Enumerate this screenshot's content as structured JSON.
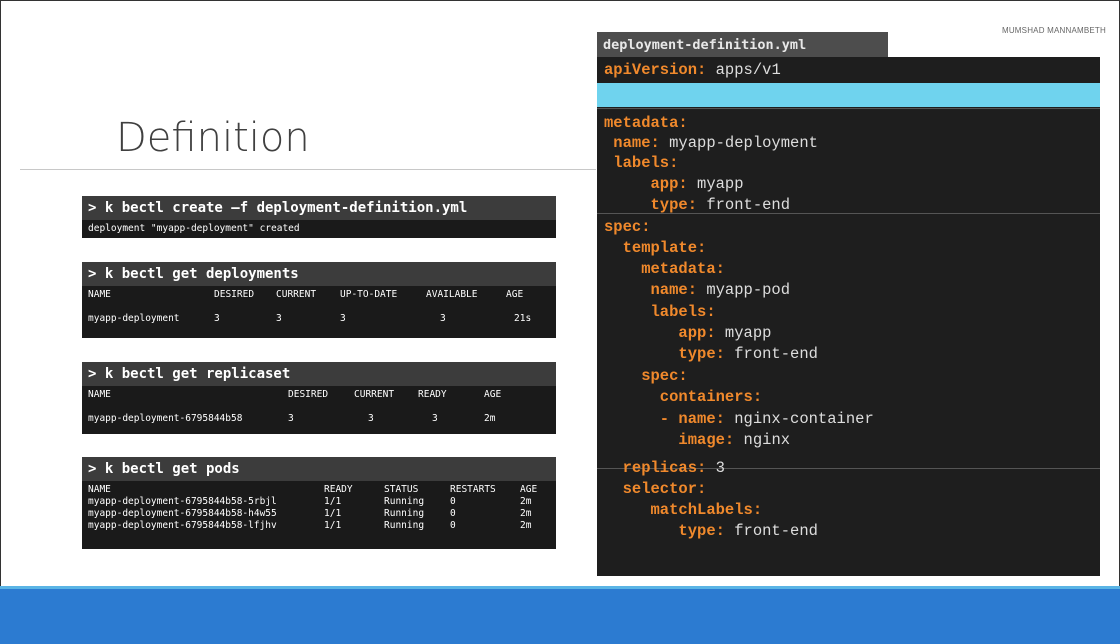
{
  "author": "MUMSHAD MANNAMBETH",
  "title": "Definition",
  "terminals": {
    "create": {
      "command": "> k bectl create –f deployment-definition.yml",
      "output": "deployment \"myapp-deployment\" created"
    },
    "deployments": {
      "command": "> k bectl get deployments",
      "headers": [
        "NAME",
        "DESIRED",
        "CURRENT",
        "UP-TO-DATE",
        "AVAILABLE",
        "AGE"
      ],
      "rows": [
        [
          "myapp-deployment",
          "3",
          "3",
          "3",
          "3",
          "21s"
        ]
      ]
    },
    "replicaset": {
      "command": "> k bectl get replicaset",
      "headers": [
        "NAME",
        "DESIRED",
        "CURRENT",
        "READY",
        "AGE"
      ],
      "rows": [
        [
          "myapp-deployment-6795844b58",
          "3",
          "3",
          "3",
          "2m"
        ]
      ]
    },
    "pods": {
      "command": "> k bectl get pods",
      "headers": [
        "NAME",
        "READY",
        "STATUS",
        "RESTARTS",
        "AGE"
      ],
      "rows": [
        [
          "myapp-deployment-6795844b58-5rbjl",
          "1/1",
          "Running",
          "0",
          "2m"
        ],
        [
          "myapp-deployment-6795844b58-h4w55",
          "1/1",
          "Running",
          "0",
          "2m"
        ],
        [
          "myapp-deployment-6795844b58-lfjhv",
          "1/1",
          "Running",
          "0",
          "2m"
        ]
      ]
    }
  },
  "yaml": {
    "filename": "deployment-definition.yml",
    "lines": [
      {
        "key": "apiVersion:",
        "value": " apps/v1"
      },
      {
        "key": "metadata:",
        "value": ""
      },
      {
        "key": " name:",
        "value": " myapp-deployment"
      },
      {
        "key": " labels:",
        "value": ""
      },
      {
        "key": "     app:",
        "value": " myapp"
      },
      {
        "key": "     type:",
        "value": " front-end"
      },
      {
        "key": "spec:",
        "value": ""
      },
      {
        "key": "  template:",
        "value": ""
      },
      {
        "key": "    metadata:",
        "value": ""
      },
      {
        "key": "     name:",
        "value": " myapp-pod"
      },
      {
        "key": "     labels:",
        "value": ""
      },
      {
        "key": "        app:",
        "value": " myapp"
      },
      {
        "key": "        type:",
        "value": " front-end"
      },
      {
        "key": "    spec:",
        "value": ""
      },
      {
        "key": "      containers:",
        "value": ""
      },
      {
        "key": "      - name:",
        "value": " nginx-container"
      },
      {
        "key": "        image:",
        "value": " nginx"
      },
      {
        "key": "  replicas:",
        "value": " 3"
      },
      {
        "key": "  selector:",
        "value": ""
      },
      {
        "key": "     matchLabels:",
        "value": ""
      },
      {
        "key": "        type:",
        "value": " front-end"
      }
    ]
  },
  "colors": {
    "footer": "#2c7bd1",
    "yaml_key": "#f0892c",
    "yaml_highlight": "#6fd3ee"
  }
}
